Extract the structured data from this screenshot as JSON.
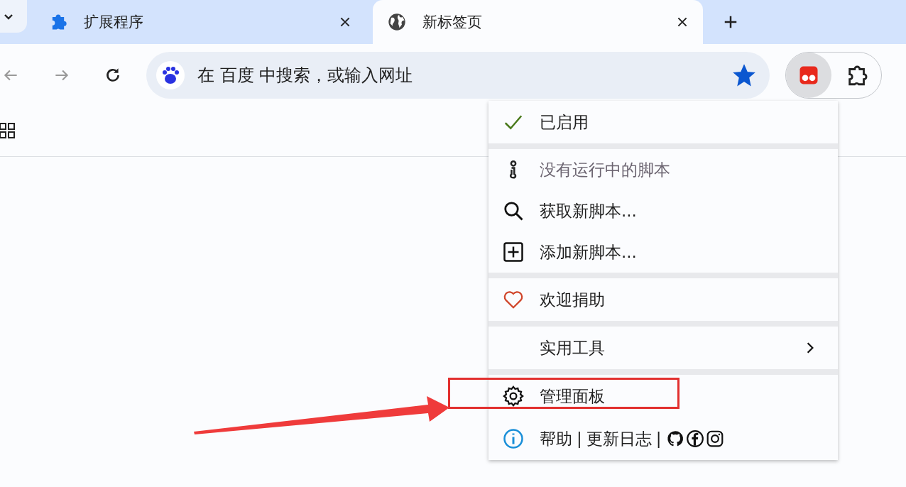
{
  "tabs": [
    {
      "label": "扩展程序",
      "selected": false
    },
    {
      "label": "新标签页",
      "selected": true
    }
  ],
  "omnibox": {
    "placeholder": "在 百度 中搜索，或输入网址",
    "bookmarked": true
  },
  "extension_menu": {
    "sections": [
      [
        {
          "kind": "check",
          "text": "已启用",
          "checked": true
        }
      ],
      [
        {
          "kind": "info",
          "text": "没有运行中的脚本",
          "disabled": true
        },
        {
          "kind": "search",
          "text": "获取新脚本...",
          "disabled": false
        },
        {
          "kind": "add",
          "text": "添加新脚本...",
          "disabled": false
        }
      ],
      [
        {
          "kind": "heart",
          "text": "欢迎捐助"
        }
      ],
      [
        {
          "kind": "submenu",
          "text": "实用工具"
        }
      ],
      [
        {
          "kind": "gear",
          "text": "管理面板",
          "highlighted": true
        },
        {
          "kind": "links",
          "links": [
            "帮助",
            "更新日志"
          ],
          "separator": "|"
        }
      ]
    ]
  }
}
